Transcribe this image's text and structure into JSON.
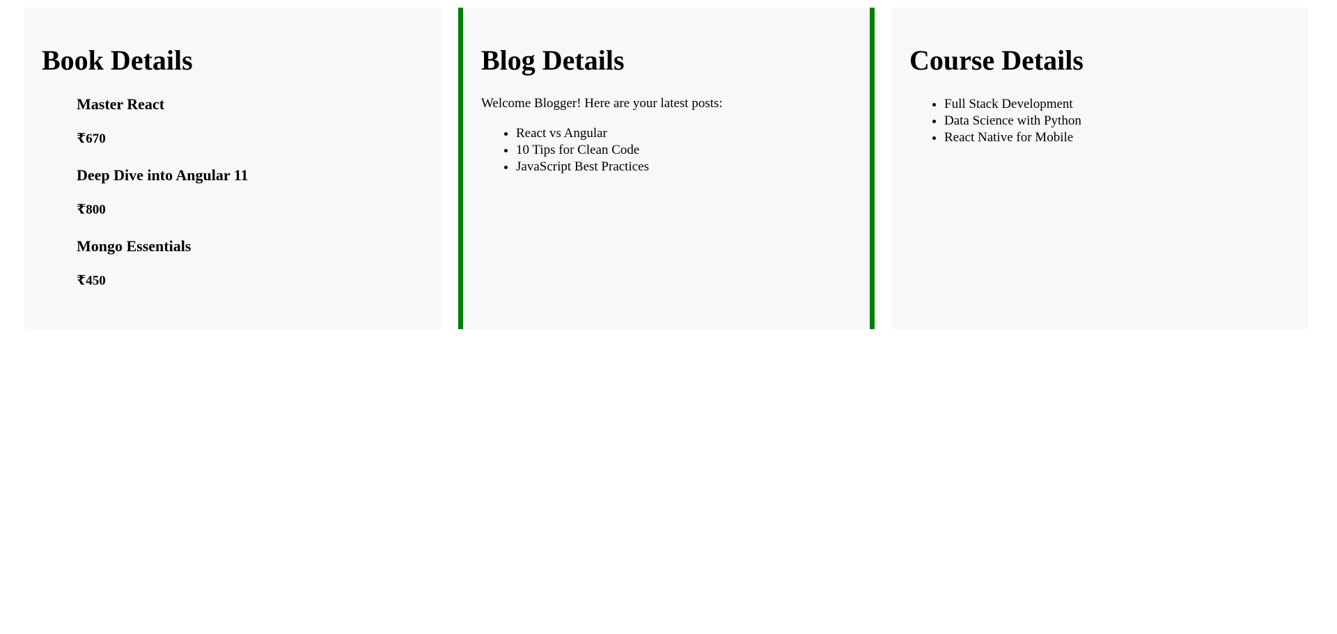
{
  "book_panel": {
    "title": "Book Details",
    "books": [
      {
        "name": "Master React",
        "price": "₹670"
      },
      {
        "name": "Deep Dive into Angular 11",
        "price": "₹800"
      },
      {
        "name": "Mongo Essentials",
        "price": "₹450"
      }
    ]
  },
  "blog_panel": {
    "title": "Blog Details",
    "intro": "Welcome Blogger! Here are your latest posts:",
    "posts": [
      "React vs Angular",
      "10 Tips for Clean Code",
      "JavaScript Best Practices"
    ],
    "border_color": "#008000"
  },
  "course_panel": {
    "title": "Course Details",
    "courses": [
      "Full Stack Development",
      "Data Science with Python",
      "React Native for Mobile"
    ]
  }
}
